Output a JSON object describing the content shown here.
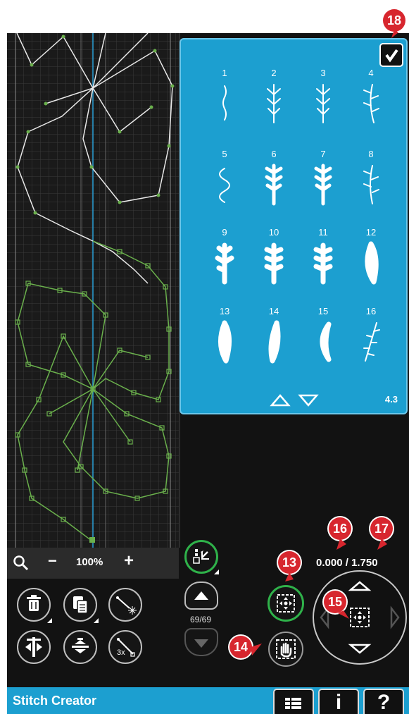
{
  "zoom": {
    "level": "100%",
    "minus": "−",
    "plus": "+"
  },
  "stitch_menu": {
    "stitches": [
      {
        "num": "1"
      },
      {
        "num": "2"
      },
      {
        "num": "3"
      },
      {
        "num": "4"
      },
      {
        "num": "5"
      },
      {
        "num": "6"
      },
      {
        "num": "7"
      },
      {
        "num": "8"
      },
      {
        "num": "9"
      },
      {
        "num": "10"
      },
      {
        "num": "11"
      },
      {
        "num": "12"
      },
      {
        "num": "13"
      },
      {
        "num": "14"
      },
      {
        "num": "15"
      },
      {
        "num": "16"
      }
    ],
    "page": "4.3"
  },
  "stitch_counter": "69/69",
  "coordinates": "0.000 / 1.750",
  "bottom_bar": {
    "title": "Stitch Creator",
    "info_label": "i",
    "help_label": "?"
  },
  "badges": {
    "b13": "13",
    "b14": "14",
    "b15": "15",
    "b16": "16",
    "b17": "17",
    "b18": "18"
  },
  "colors": {
    "accent_blue": "#1c9fd0",
    "stitch_green": "#6ab04c",
    "badge_red": "#d7262e",
    "ok_green": "#2fb24a"
  }
}
